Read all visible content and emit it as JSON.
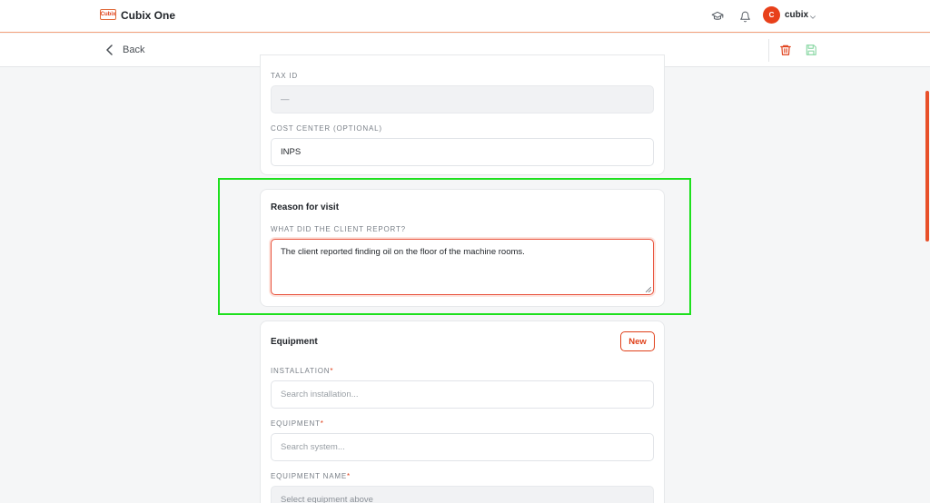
{
  "app": {
    "logo_text": "Cubix",
    "title": "Cubix One"
  },
  "user": {
    "initial": "C",
    "name": "cubix"
  },
  "nav": {
    "back_label": "Back"
  },
  "customer_card": {
    "tax_id_label": "TAX ID",
    "tax_id_value": "—",
    "cost_center_label": "COST CENTER (OPTIONAL)",
    "cost_center_value": "INPS"
  },
  "reason_card": {
    "title": "Reason for visit",
    "report_label": "WHAT DID THE CLIENT REPORT?",
    "report_value": "The client reported finding oil on the floor of the machine rooms."
  },
  "equipment_card": {
    "title": "Equipment",
    "new_button": "New",
    "installation_label": "INSTALLATION",
    "installation_placeholder": "Search installation...",
    "equipment_label": "EQUIPMENT",
    "equipment_placeholder": "Search system...",
    "equipment_name_label": "EQUIPMENT NAME",
    "equipment_name_placeholder": "Select equipment above",
    "required_mark": "*"
  },
  "colors": {
    "accent": "#e8401a",
    "highlight": "#1ee01e",
    "save_icon": "#8fd9a8"
  },
  "icons": {
    "courses": "graduation-cap-icon",
    "notifications": "bell-icon",
    "delete": "trash-icon",
    "save": "save-icon"
  }
}
